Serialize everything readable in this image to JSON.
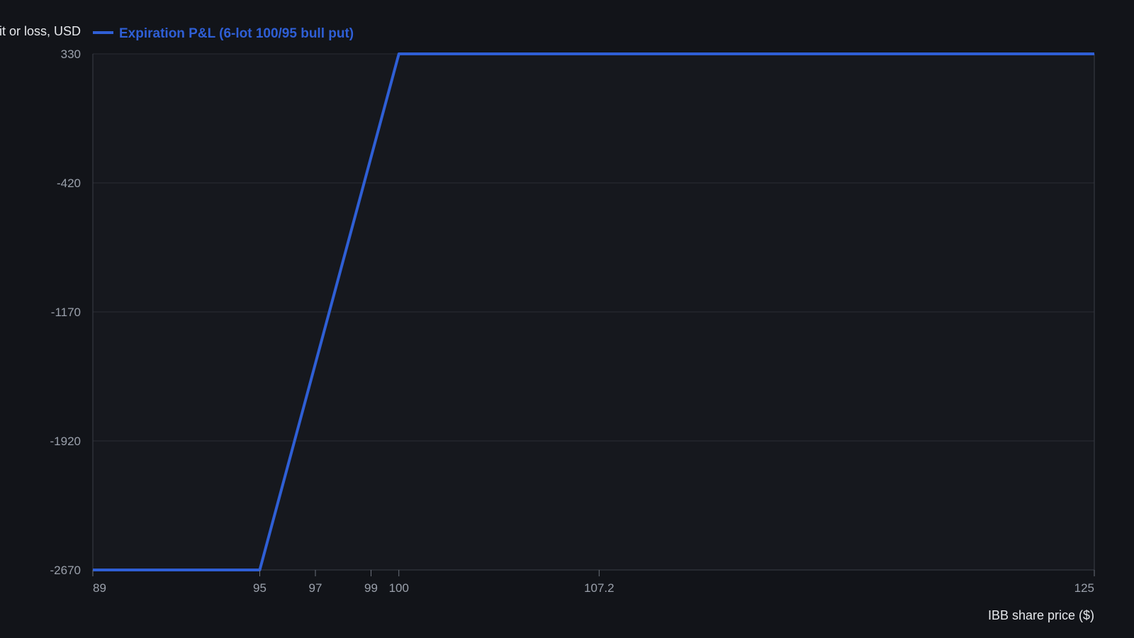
{
  "chart_data": {
    "type": "line",
    "ylabel": "Profit or loss, USD",
    "xlabel": "IBB share price ($)",
    "xlim": [
      89,
      125
    ],
    "ylim": [
      -2670,
      330
    ],
    "x_ticks": [
      89,
      95,
      97,
      99,
      100,
      107.2,
      125
    ],
    "y_ticks": [
      330,
      -420,
      -1170,
      -1920,
      -2670
    ],
    "grid": "horizontal",
    "legend_placement": "top-left",
    "series": [
      {
        "name": "Expiration P&L (6-lot 100/95 bull put)",
        "color": "#2f5fd6",
        "x": [
          89,
          95,
          100,
          125
        ],
        "y": [
          -2670,
          -2670,
          330,
          330
        ]
      }
    ]
  },
  "colors": {
    "background": "#121419",
    "plot_background": "#16181e",
    "grid": "#2a2d34",
    "axis": "#3a3e46"
  }
}
